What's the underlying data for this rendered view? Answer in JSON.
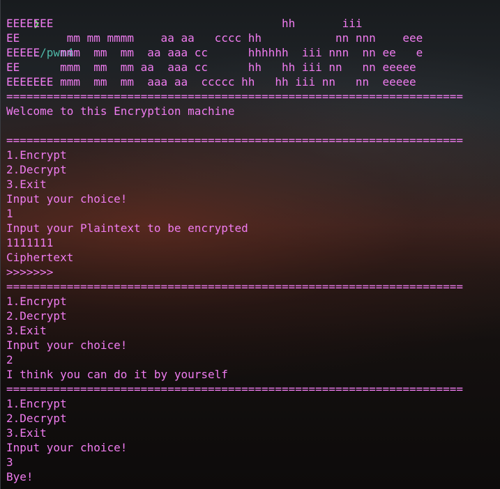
{
  "prompt": {
    "arrow": "❯",
    "command": "./pwn4"
  },
  "colors": {
    "text": "#f07cf0",
    "prompt_arrow": "#5fd75f",
    "prompt_command": "#4fb8a8"
  },
  "output": [
    "EEEEEEE                                  hh       iii",
    "EE       mm mm mmmm    aa aa   cccc hh           nn nnn    eee",
    "EEEEE   mmm  mm  mm  aa aaa cc      hhhhhh  iii nnn  nn ee   e",
    "EE      mmm  mm  mm aa  aaa cc      hh   hh iii nn   nn eeeee",
    "EEEEEEE mmm  mm  mm  aaa aa  ccccc hh   hh iii nn   nn  eeeee",
    "====================================================================",
    "Welcome to this Encryption machine",
    "",
    "====================================================================",
    "1.Encrypt",
    "2.Decrypt",
    "3.Exit",
    "Input your choice!",
    "1",
    "Input your Plaintext to be encrypted",
    "1111111",
    "Ciphertext",
    ">>>>>>>",
    "====================================================================",
    "1.Encrypt",
    "2.Decrypt",
    "3.Exit",
    "Input your choice!",
    "2",
    "I think you can do it by yourself",
    "====================================================================",
    "1.Encrypt",
    "2.Decrypt",
    "3.Exit",
    "Input your choice!",
    "3",
    "Bye!"
  ]
}
